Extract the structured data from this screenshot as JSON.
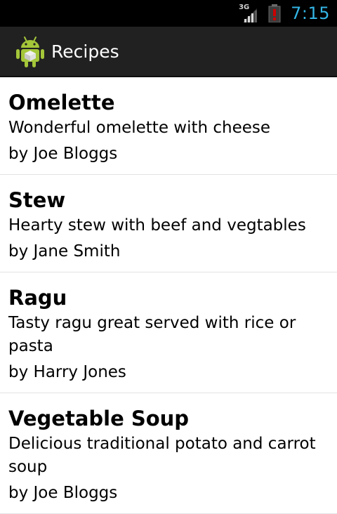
{
  "status_bar": {
    "network_type": "3G",
    "time": "7:15",
    "icons": [
      "signal-icon",
      "battery-alert-icon"
    ]
  },
  "action_bar": {
    "title": "Recipes",
    "icon": "android-app-icon"
  },
  "recipes": [
    {
      "name": "Omelette",
      "description": "Wonderful omelette with cheese",
      "author": "by Joe Bloggs"
    },
    {
      "name": "Stew",
      "description": "Hearty stew with beef and vegtables",
      "author": "by Jane Smith"
    },
    {
      "name": "Ragu",
      "description": "Tasty ragu great served with rice or pasta",
      "author": "by Harry Jones"
    },
    {
      "name": "Vegetable Soup",
      "description": "Delicious traditional potato and carrot soup",
      "author": "by Joe Bloggs"
    }
  ],
  "colors": {
    "status_bar_bg": "#000000",
    "clock": "#33b5e5",
    "action_bar_bg": "#212121",
    "android_green": "#a4c639",
    "battery_alert": "#cc0000",
    "divider": "#e3e3e3"
  }
}
